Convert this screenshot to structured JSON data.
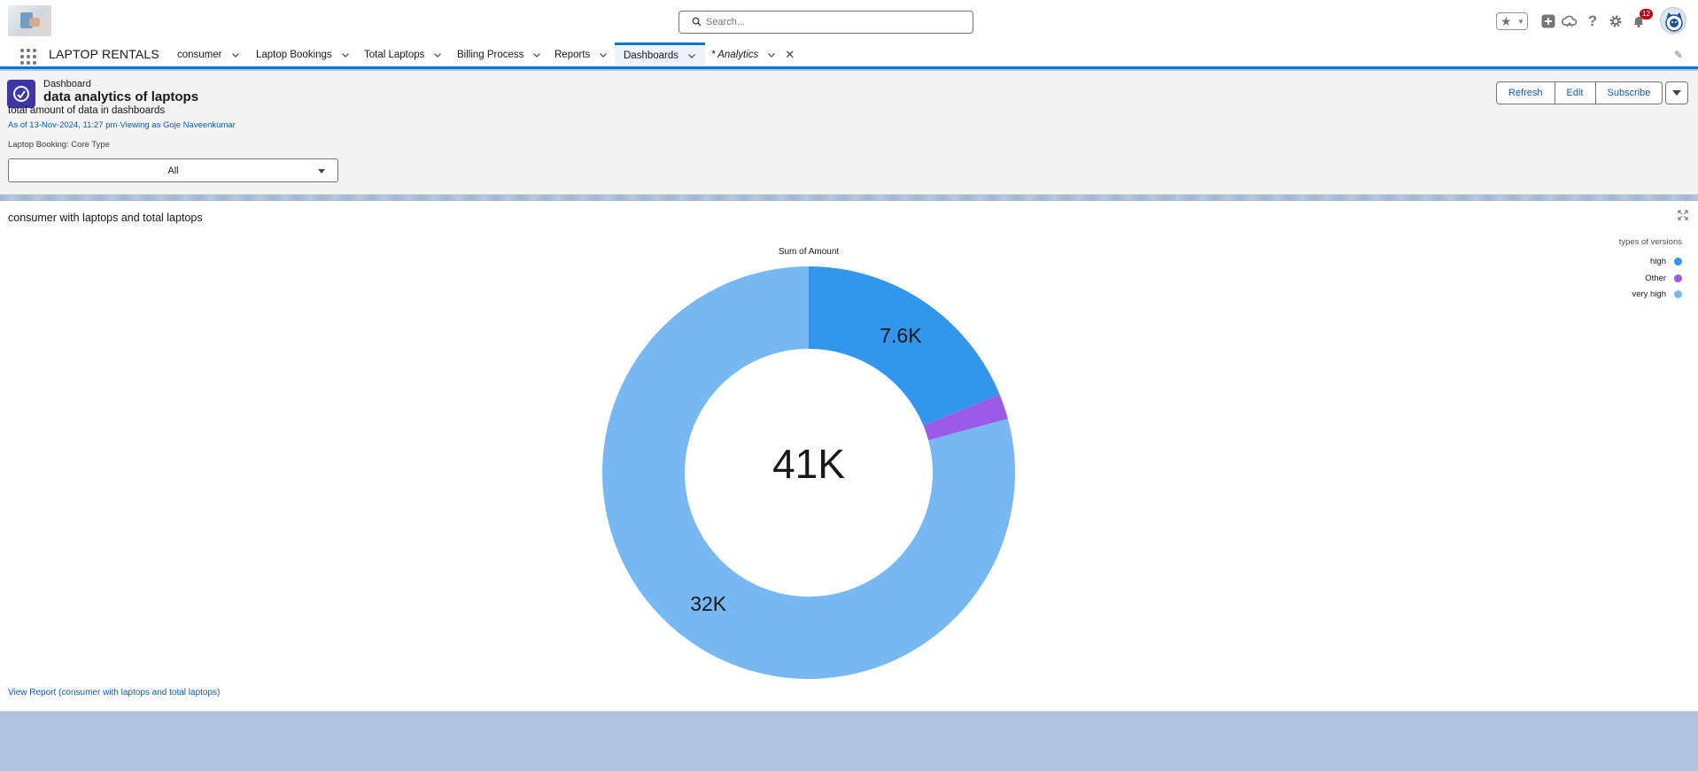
{
  "header": {
    "search_placeholder": "Search...",
    "notification_count": "12"
  },
  "nav": {
    "app_name": "LAPTOP RENTALS",
    "tabs": [
      {
        "label": "consumer"
      },
      {
        "label": "Laptop Bookings"
      },
      {
        "label": "Total Laptops"
      },
      {
        "label": "Billing Process"
      },
      {
        "label": "Reports"
      },
      {
        "label": "Dashboards"
      },
      {
        "label": "* Analytics"
      }
    ]
  },
  "dashboard": {
    "type_label": "Dashboard",
    "title": "data analytics of laptops",
    "description": "total amount of data in dashboards",
    "meta": "As of 13-Nov-2024, 11:27 pm·Viewing as Goje Naveenkumar",
    "filter_label": "Laptop Booking: Core Type",
    "filter_value": "All",
    "buttons": {
      "refresh": "Refresh",
      "edit": "Edit",
      "subscribe": "Subscribe"
    }
  },
  "widget": {
    "title": "consumer with laptops and total laptops",
    "view_report": "View Report (consumer with laptops and total laptops)"
  },
  "chart_data": {
    "type": "pie",
    "subtype": "donut",
    "title": "Sum of Amount",
    "center_label": "41K",
    "legend_title": "types of versions",
    "legend_placement": "top-right",
    "categories": [
      "high",
      "Other",
      "very high"
    ],
    "values": [
      7600,
      800,
      32000
    ],
    "data_labels": [
      "7.6K",
      "",
      "32K"
    ],
    "colors": [
      "#3296ed",
      "#9c5be6",
      "#77b8f3"
    ]
  }
}
